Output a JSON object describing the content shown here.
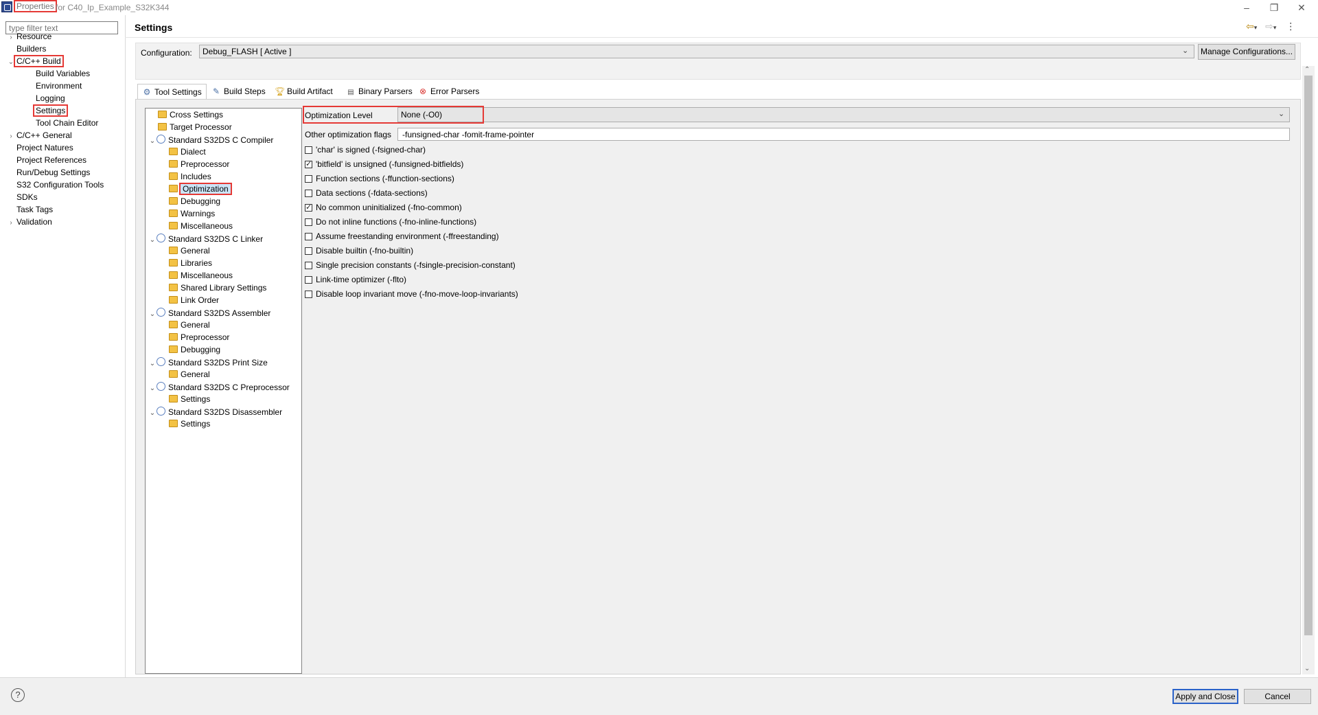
{
  "window": {
    "title_highlight": "Properties",
    "title_rest": "for C40_Ip_Example_S32K344",
    "controls": [
      "minimize-icon",
      "restore-icon",
      "close-icon"
    ]
  },
  "left": {
    "filter_placeholder": "type filter text",
    "items": [
      {
        "label": "Resource",
        "arrow": "›"
      },
      {
        "label": "Builders",
        "arrow": ""
      },
      {
        "label": "C/C++ Build",
        "arrow": "⌄"
      },
      {
        "label": "Build Variables",
        "arrow": ""
      },
      {
        "label": "Environment",
        "arrow": ""
      },
      {
        "label": "Logging",
        "arrow": ""
      },
      {
        "label": "Settings",
        "arrow": ""
      },
      {
        "label": "Tool Chain Editor",
        "arrow": ""
      },
      {
        "label": "C/C++ General",
        "arrow": "›"
      },
      {
        "label": "Project Natures",
        "arrow": ""
      },
      {
        "label": "Project References",
        "arrow": ""
      },
      {
        "label": "Run/Debug Settings",
        "arrow": ""
      },
      {
        "label": "S32 Configuration Tools",
        "arrow": ""
      },
      {
        "label": "SDKs",
        "arrow": ""
      },
      {
        "label": "Task Tags",
        "arrow": ""
      },
      {
        "label": "Validation",
        "arrow": "›"
      }
    ]
  },
  "header": {
    "title": "Settings",
    "icons": [
      "back-arrow-icon",
      "dropdown-icon",
      "forward-arrow-icon",
      "dropdown-icon",
      "more-icon"
    ]
  },
  "config": {
    "label": "Configuration:",
    "value": "Debug_FLASH  [ Active ]",
    "manage_label": "Manage Configurations..."
  },
  "tabs": [
    {
      "label": "Tool Settings",
      "icon": "tool-settings-icon"
    },
    {
      "label": "Build Steps",
      "icon": "build-steps-icon"
    },
    {
      "label": "Build Artifact",
      "icon": "build-artifact-icon"
    },
    {
      "label": "Binary Parsers",
      "icon": "binary-parsers-icon"
    },
    {
      "label": "Error Parsers",
      "icon": "error-parsers-icon"
    }
  ],
  "tree": [
    {
      "label": "Cross Settings",
      "level": 1,
      "icon": "folder"
    },
    {
      "label": "Target Processor",
      "level": 1,
      "icon": "folder"
    },
    {
      "label": "Standard S32DS C Compiler",
      "level": 0,
      "icon": "tool"
    },
    {
      "label": "Dialect",
      "level": 2,
      "icon": "folder"
    },
    {
      "label": "Preprocessor",
      "level": 2,
      "icon": "folder"
    },
    {
      "label": "Includes",
      "level": 2,
      "icon": "folder"
    },
    {
      "label": "Optimization",
      "level": 2,
      "icon": "folder"
    },
    {
      "label": "Debugging",
      "level": 2,
      "icon": "folder"
    },
    {
      "label": "Warnings",
      "level": 2,
      "icon": "folder"
    },
    {
      "label": "Miscellaneous",
      "level": 2,
      "icon": "folder"
    },
    {
      "label": "Standard S32DS C Linker",
      "level": 0,
      "icon": "tool"
    },
    {
      "label": "General",
      "level": 2,
      "icon": "folder"
    },
    {
      "label": "Libraries",
      "level": 2,
      "icon": "folder"
    },
    {
      "label": "Miscellaneous",
      "level": 2,
      "icon": "folder"
    },
    {
      "label": "Shared Library Settings",
      "level": 2,
      "icon": "folder"
    },
    {
      "label": "Link Order",
      "level": 2,
      "icon": "folder"
    },
    {
      "label": "Standard S32DS Assembler",
      "level": 0,
      "icon": "tool"
    },
    {
      "label": "General",
      "level": 2,
      "icon": "folder"
    },
    {
      "label": "Preprocessor",
      "level": 2,
      "icon": "folder"
    },
    {
      "label": "Debugging",
      "level": 2,
      "icon": "folder"
    },
    {
      "label": "Standard S32DS Print Size",
      "level": 0,
      "icon": "tool"
    },
    {
      "label": "General",
      "level": 2,
      "icon": "folder"
    },
    {
      "label": "Standard S32DS C Preprocessor",
      "level": 0,
      "icon": "tool"
    },
    {
      "label": "Settings",
      "level": 2,
      "icon": "folder"
    },
    {
      "label": "Standard S32DS Disassembler",
      "level": 0,
      "icon": "tool"
    },
    {
      "label": "Settings",
      "level": 2,
      "icon": "folder"
    }
  ],
  "options": {
    "level_label": "Optimization Level",
    "level_value": "None (-O0)",
    "other_label": "Other optimization flags",
    "other_value": "-funsigned-char -fomit-frame-pointer",
    "checkboxes": [
      {
        "label": "'char' is signed (-fsigned-char)",
        "checked": false
      },
      {
        "label": "'bitfield' is unsigned (-funsigned-bitfields)",
        "checked": true
      },
      {
        "label": "Function sections (-ffunction-sections)",
        "checked": false
      },
      {
        "label": "Data sections (-fdata-sections)",
        "checked": false
      },
      {
        "label": "No common uninitialized (-fno-common)",
        "checked": true
      },
      {
        "label": "Do not inline functions (-fno-inline-functions)",
        "checked": false
      },
      {
        "label": "Assume freestanding environment (-ffreestanding)",
        "checked": false
      },
      {
        "label": "Disable builtin (-fno-builtin)",
        "checked": false
      },
      {
        "label": "Single precision constants (-fsingle-precision-constant)",
        "checked": false
      },
      {
        "label": "Link-time optimizer (-flto)",
        "checked": false
      },
      {
        "label": "Disable loop invariant move (-fno-move-loop-invariants)",
        "checked": false
      }
    ]
  },
  "footer": {
    "apply_label": "Apply and Close",
    "cancel_label": "Cancel"
  },
  "colors": {
    "highlight_box": "#e53935",
    "default_button_border": "#2a62c9"
  }
}
